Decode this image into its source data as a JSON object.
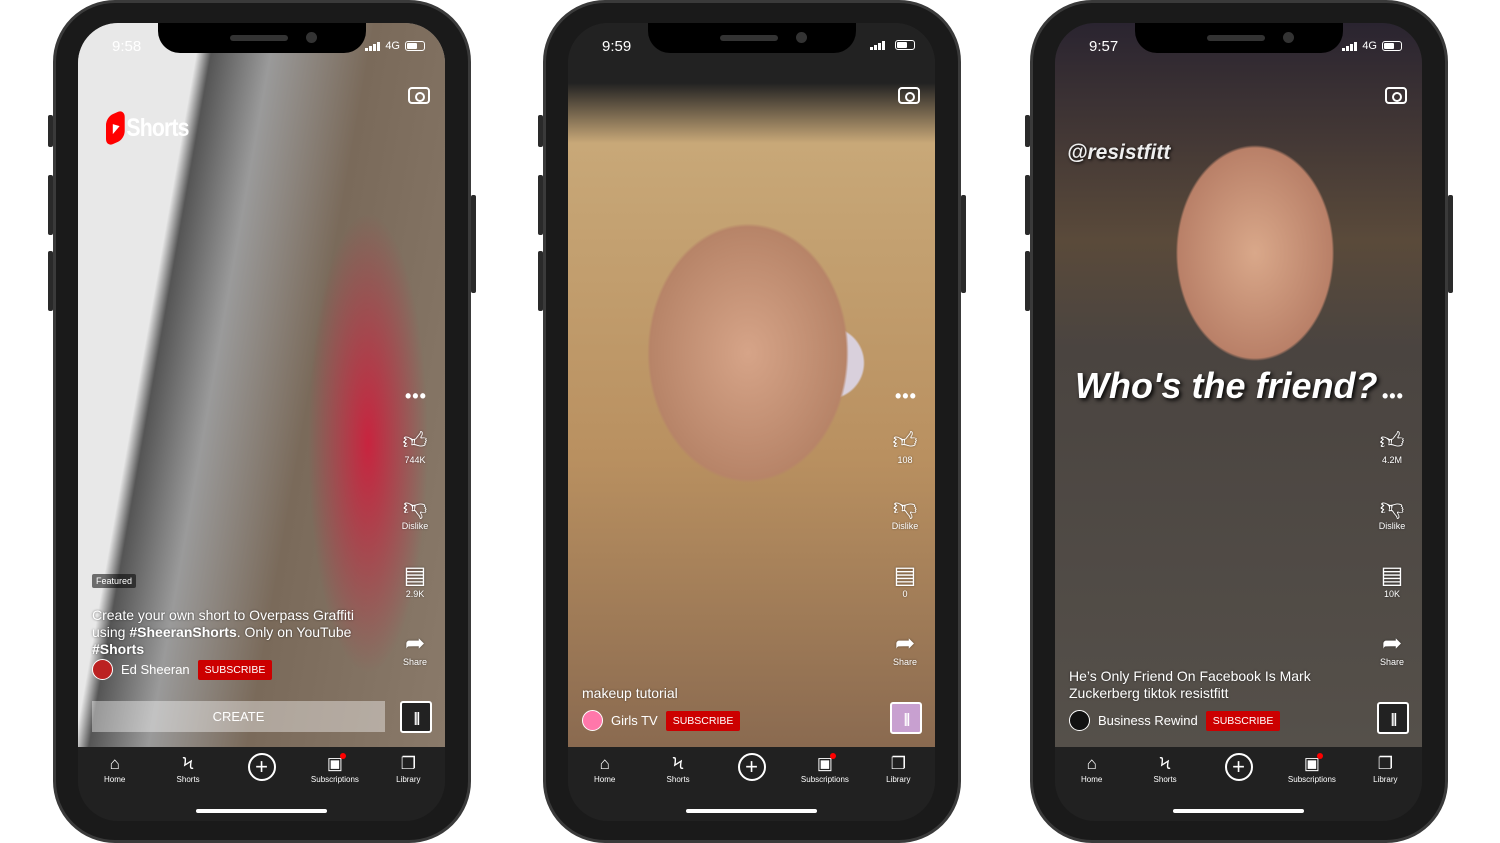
{
  "colors": {
    "subscribe": "#cc0000",
    "brand": "#ff0000",
    "nav_bg": "#212121"
  },
  "nav": [
    {
      "label": "Home",
      "icon": "home-icon"
    },
    {
      "label": "Shorts",
      "icon": "shorts-icon"
    },
    {
      "label": "",
      "icon": "create-plus-icon"
    },
    {
      "label": "Subscriptions",
      "icon": "subscriptions-icon"
    },
    {
      "label": "Library",
      "icon": "library-icon"
    }
  ],
  "phones": [
    {
      "time": "9:58",
      "network": "4G",
      "brand": "Shorts",
      "featured": "Featured",
      "description_html": [
        "Create your own short to Overpass Graffiti using ",
        "#SheeranShorts",
        ". Only on YouTube ",
        "#Shorts"
      ],
      "channel": "Ed Sheeran",
      "subscribe": "SUBSCRIBE",
      "create": "CREATE",
      "likes": "744K",
      "dislike": "Dislike",
      "comments": "2.9K",
      "share": "Share"
    },
    {
      "time": "9:59",
      "network": "",
      "description": "makeup tutorial",
      "channel": "Girls TV",
      "subscribe": "SUBSCRIBE",
      "likes": "108",
      "dislike": "Dislike",
      "comments": "0",
      "share": "Share"
    },
    {
      "time": "9:57",
      "network": "4G",
      "overlay_handle": "@resistfitt",
      "overlay_caption": "Who's the friend?",
      "description": "He’s Only Friend On Facebook Is Mark Zuckerberg tiktok resistfitt",
      "channel": "Business Rewind",
      "subscribe": "SUBSCRIBE",
      "likes": "4.2M",
      "dislike": "Dislike",
      "comments": "10K",
      "share": "Share"
    }
  ]
}
